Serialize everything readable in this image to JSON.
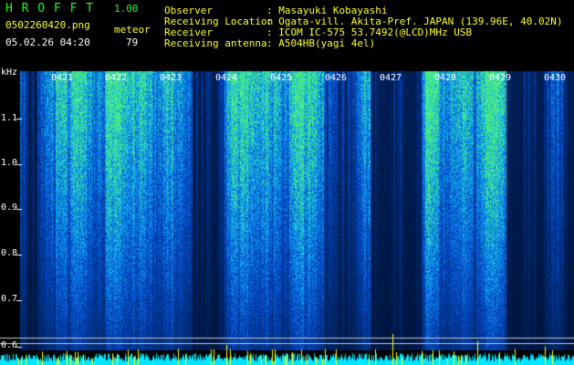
{
  "header": {
    "app_name": "H R O F F T",
    "version": "1.00",
    "file_name": "0502260420.png",
    "mode_label": "meteor",
    "timestamp": "05.02.26 04:20",
    "meteor_count": "79",
    "info_rows": [
      {
        "label": "Observer",
        "value": ": Masayuki Kobayashi"
      },
      {
        "label": "Receiving Location",
        "value": ": Ogata-vill. Akita-Pref. JAPAN (139.96E, 40.02N)"
      },
      {
        "label": "Receiver",
        "value": ": ICOM IC-575 53.7492(@LCD)MHz USB"
      },
      {
        "label": "Receiving antenna",
        "value": ": A504HB(yagi 4el)"
      }
    ]
  },
  "axis": {
    "unit": "kHz",
    "y_ticks": [
      "1.1",
      "1.0",
      "0.9",
      "0.8",
      "0.7",
      "0.6"
    ],
    "time_ticks": [
      "0421",
      "0422",
      "0423",
      "0424",
      "0425",
      "0426",
      "0427",
      "0428",
      "0429",
      "0430"
    ]
  },
  "colors": {
    "label_green": "#1eff1e",
    "text_yellow": "#ffff2a",
    "text_white": "#ffffff",
    "spectro_low": "#0a1a8c",
    "spectro_mid": "#1e6ee6",
    "spectro_high": "#32e68c",
    "baseline_cyan": "#00e6ff",
    "meteor_yellow": "#ffff00"
  }
}
